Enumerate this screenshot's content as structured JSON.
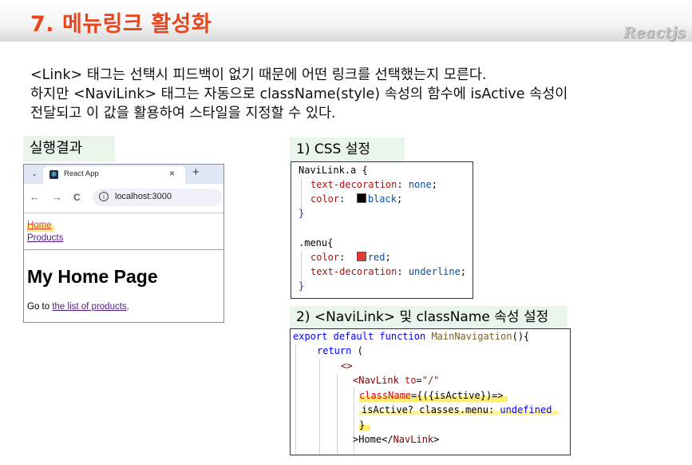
{
  "header": {
    "title": "7. 메뉴링크 활성화",
    "brand": "Reactjs"
  },
  "intro": [
    "<Link> 태그는 선택시 피드백이 없기 때문에 어떤 링크를 선택했는지 모른다.",
    "하지만 <NaviLink> 태그는 자동으로 className(style) 속성의 함수에 isActive 속성이",
    "전달되고 이 값을 활용하여 스타일을 지정할 수 있다."
  ],
  "labels": {
    "result": "실행결과",
    "css": "1) CSS 설정",
    "navlink": "2) <NaviLink> 및 className  속성 설정"
  },
  "browser": {
    "tab_title": "React App",
    "tab_close": "×",
    "new_tab": "+",
    "dropdown": "⌄",
    "back": "←",
    "forward": "→",
    "reload": "C",
    "info": "i",
    "url": "localhost:3000",
    "nav_home": "Home",
    "nav_products": "Products",
    "heading": "My Home Page",
    "body_prefix": "Go to ",
    "body_link": "the list of products",
    "body_suffix": ".",
    "colors": {
      "home_link": "#e53935",
      "visited_link": "#551a8b",
      "tab_bar": "#dfe6f5"
    }
  },
  "css_code": {
    "l1_sel": "NaviLink.a",
    "l1_brace": " {",
    "l2_prop": "text-decoration",
    "l2_val": "none",
    "l3_prop": "color",
    "l3_val": "black",
    "l4": "}",
    "l6_sel": ".menu",
    "l6_brace": "{",
    "l7_prop": "color",
    "l7_val": "red",
    "l8_prop": "text-decoration",
    "l8_val": "underline",
    "l9": "}",
    "swatch_black": "#000000",
    "swatch_red": "#e53935"
  },
  "jsx_code": {
    "l1_kw1": "export",
    "l1_kw2": "default",
    "l1_kw3": "function",
    "l1_fn": "MainNavigation",
    "l1_rest": "(){",
    "l2_kw": "return",
    "l2_rest": " (",
    "l3": "<>",
    "l4_open": "<NavLink",
    "l4_attr": "to",
    "l4_eq": "=",
    "l4_str": "\"/\"",
    "l5_attr": "className",
    "l5_rest": "={({isActive})=>",
    "l6_a": "isActive? classes.menu: ",
    "l6_b": "undefined",
    "l7": "}",
    "l8_a": ">Home</",
    "l8_b": "NavLink",
    "l8_c": ">"
  }
}
